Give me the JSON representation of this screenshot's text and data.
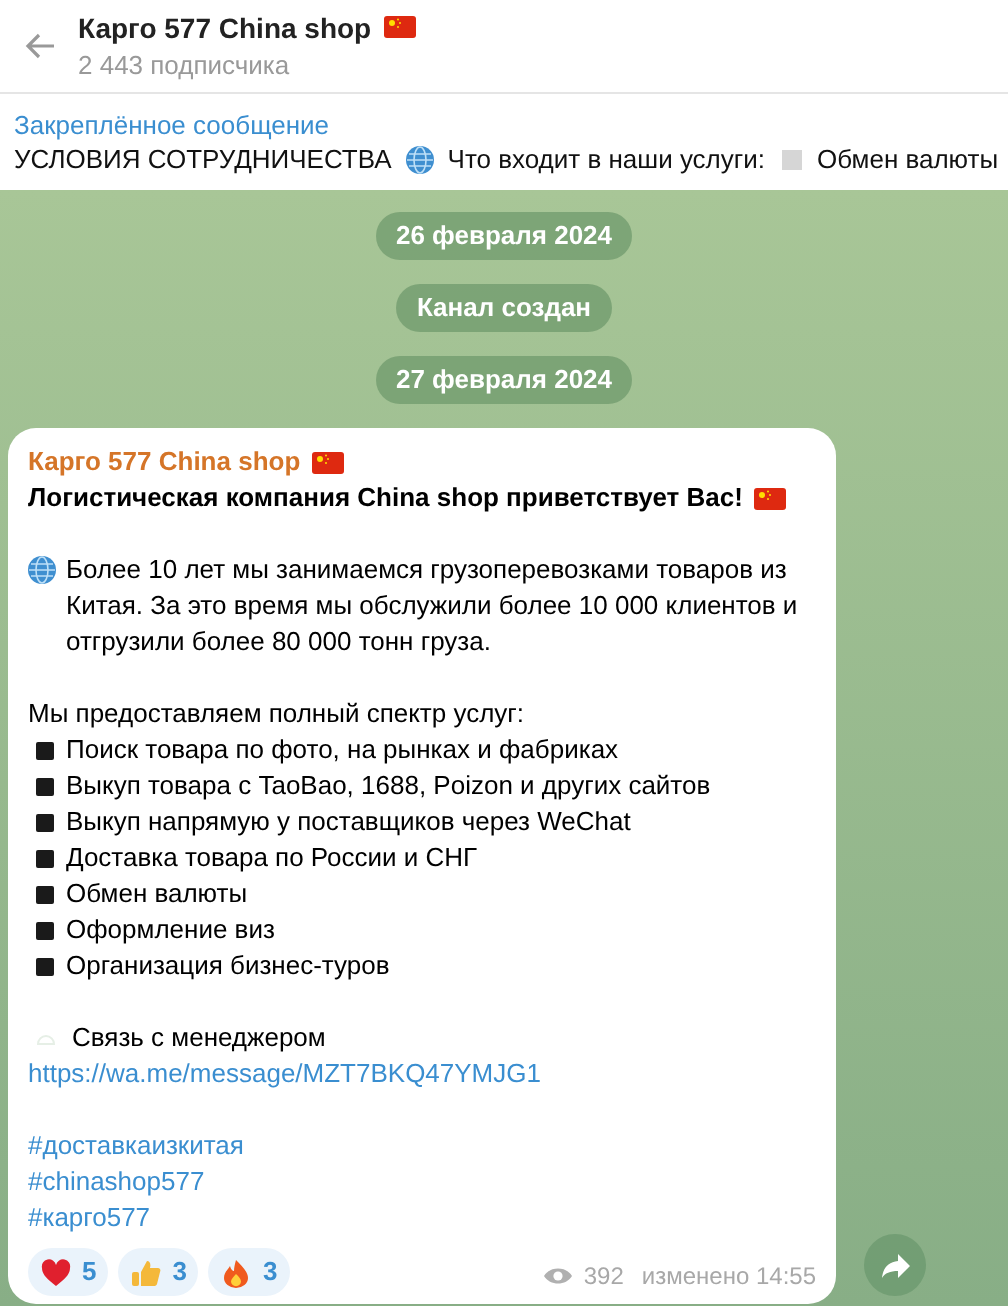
{
  "header": {
    "title": "Карго 577 China shop",
    "subscribers": "2 443 подписчика"
  },
  "pinned": {
    "label": "Закреплённое сообщение",
    "preview": [
      "УСЛОВИЯ СОТРУДНИЧЕСТВА",
      "Что входит в наши услуги:",
      "Обмен валюты"
    ]
  },
  "service_messages": [
    "26 февраля 2024",
    "Канал создан",
    "27 февраля 2024"
  ],
  "message": {
    "sender": "Карго 577 China shop",
    "headline": "Логистическая компания China shop приветствует Вас!",
    "intro": "Более 10 лет мы занимаемся грузоперевозками товаров из Китая. За это время мы обслужили более 10 000 клиентов и отгрузили более 80 000 тонн груза.",
    "services_heading": "Мы предоставляем полный спектр услуг:",
    "services": [
      "Поиск товара по фото, на рынках и фабриках",
      "Выкуп товара с TaoBao, 1688, Poizon и других сайтов",
      "Выкуп напрямую у поставщиков через WeChat",
      "Доставка товара по России и СНГ",
      "Обмен валюты",
      "Оформление виз",
      "Организация бизнес-туров"
    ],
    "contact_label": "Связь с менеджером",
    "link": "https://wa.me/message/MZT7BKQ47YMJG1",
    "hashtags": [
      "#доставкаизкитая",
      "#chinashop577",
      "#карго577"
    ],
    "reactions": [
      {
        "kind": "heart",
        "count": "5"
      },
      {
        "kind": "thumbs_up",
        "count": "3"
      },
      {
        "kind": "fire",
        "count": "3"
      }
    ],
    "views": "392",
    "edited": "изменено 14:55"
  }
}
